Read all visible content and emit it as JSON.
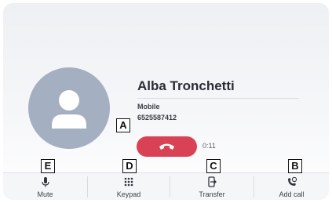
{
  "caller": {
    "name": "Alba Tronchetti",
    "number_type": "Mobile",
    "number": "6525587412",
    "duration": "0:11"
  },
  "controls": [
    {
      "key": "mute",
      "label": "Mute",
      "icon": "microphone-icon"
    },
    {
      "key": "keypad",
      "label": "Keypad",
      "icon": "keypad-icon"
    },
    {
      "key": "transfer",
      "label": "Transfer",
      "icon": "transfer-icon"
    },
    {
      "key": "add_call",
      "label": "Add call",
      "icon": "add-call-icon"
    }
  ],
  "callouts": {
    "a": "A",
    "b": "B",
    "c": "C",
    "d": "D",
    "e": "E"
  },
  "colors": {
    "end_call": "#d94155",
    "avatar": "#a4afc1",
    "icon": "#2f333a",
    "background": "#f6f7f9"
  }
}
